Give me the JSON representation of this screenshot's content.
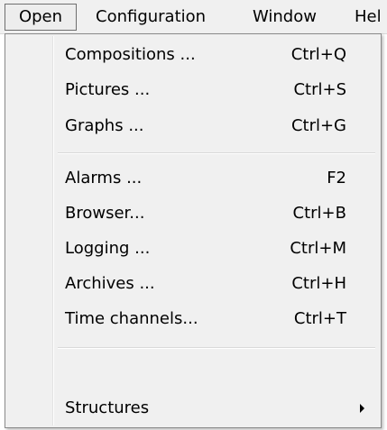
{
  "menubar": {
    "open_label": "Open",
    "configuration_label": "Configuration",
    "window_label": "Window",
    "help_label": "Hel"
  },
  "open_menu": {
    "items": [
      {
        "label": "Compositions ...",
        "shortcut": "Ctrl+Q"
      },
      {
        "label": "Pictures ...",
        "shortcut": "Ctrl+S"
      },
      {
        "label": "Graphs ...",
        "shortcut": "Ctrl+G"
      },
      {
        "label": "Alarms ...",
        "shortcut": "F2"
      },
      {
        "label": "Browser...",
        "shortcut": "Ctrl+B"
      },
      {
        "label": "Logging ...",
        "shortcut": "Ctrl+M"
      },
      {
        "label": "Archives ...",
        "shortcut": "Ctrl+H"
      },
      {
        "label": "Time channels...",
        "shortcut": "Ctrl+T"
      },
      {
        "label": "Structures",
        "shortcut": ""
      }
    ],
    "submenu_icon": "chevron-right-icon"
  }
}
